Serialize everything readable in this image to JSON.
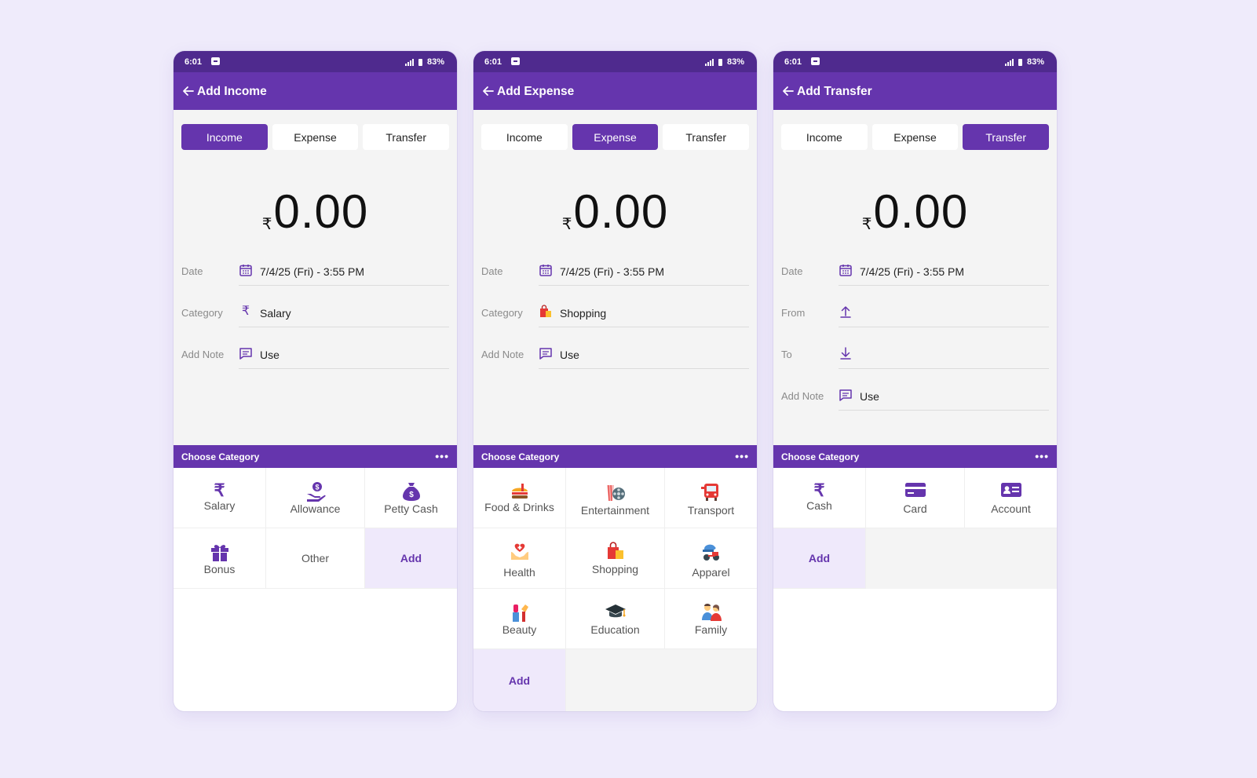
{
  "status": {
    "time": "6:01",
    "battery": "83%"
  },
  "tabs": {
    "income": "Income",
    "expense": "Expense",
    "transfer": "Transfer"
  },
  "amount": {
    "currency": "₹",
    "value": "0.00"
  },
  "labels": {
    "date": "Date",
    "category": "Category",
    "add_note": "Add Note",
    "from": "From",
    "to": "To",
    "choose_category": "Choose Category",
    "more": "•••"
  },
  "date_value": "7/4/25 (Fri) - 3:55 PM",
  "note_value": "Use",
  "income": {
    "title": "Add Income",
    "category_value": "Salary",
    "categories": [
      "Salary",
      "Allowance",
      "Petty Cash",
      "Bonus",
      "Other",
      "Add"
    ]
  },
  "expense": {
    "title": "Add Expense",
    "category_value": "Shopping",
    "categories": [
      "Food & Drinks",
      "Entertainment",
      "Transport",
      "Health",
      "Shopping",
      "Apparel",
      "Beauty",
      "Education",
      "Family",
      "Add"
    ]
  },
  "transfer": {
    "title": "Add Transfer",
    "categories": [
      "Cash",
      "Card",
      "Account",
      "Add"
    ]
  },
  "colors": {
    "primary": "#6535ad",
    "status_bar": "#4f2a8e",
    "background": "#efebfb"
  }
}
